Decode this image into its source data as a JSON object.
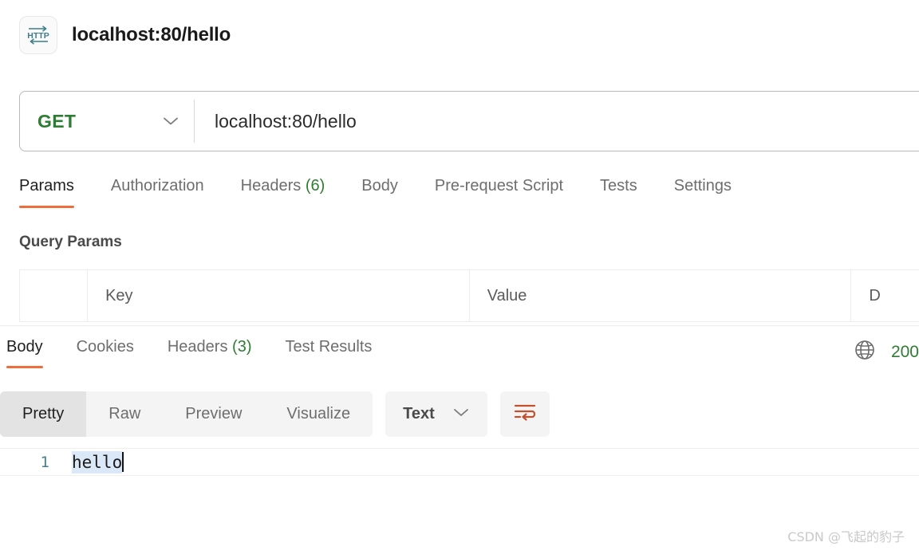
{
  "header": {
    "icon": "http-protocol-icon",
    "title": "localhost:80/hello"
  },
  "request_bar": {
    "method": "GET",
    "method_caret": "chevron-down-icon",
    "url": "localhost:80/hello"
  },
  "request_tabs": [
    {
      "label": "Params",
      "count": "",
      "active": true
    },
    {
      "label": "Authorization",
      "count": "",
      "active": false
    },
    {
      "label": "Headers",
      "count": "(6)",
      "active": false
    },
    {
      "label": "Body",
      "count": "",
      "active": false
    },
    {
      "label": "Pre-request Script",
      "count": "",
      "active": false
    },
    {
      "label": "Tests",
      "count": "",
      "active": false
    },
    {
      "label": "Settings",
      "count": "",
      "active": false
    }
  ],
  "query_params": {
    "section_title": "Query Params",
    "columns": [
      "",
      "Key",
      "Value",
      "D"
    ],
    "rows": []
  },
  "response_tabs": [
    {
      "label": "Body",
      "count": "",
      "active": true
    },
    {
      "label": "Cookies",
      "count": "",
      "active": false
    },
    {
      "label": "Headers",
      "count": "(3)",
      "active": false
    },
    {
      "label": "Test Results",
      "count": "",
      "active": false
    }
  ],
  "response_status": {
    "globe_icon": "globe-icon",
    "code": "200"
  },
  "view_toolbar": {
    "view_modes": [
      {
        "label": "Pretty",
        "active": true
      },
      {
        "label": "Raw",
        "active": false
      },
      {
        "label": "Preview",
        "active": false
      },
      {
        "label": "Visualize",
        "active": false
      }
    ],
    "format_select": {
      "value": "Text",
      "caret": "chevron-down-icon"
    },
    "wrap_button": "wrap-lines-icon"
  },
  "body_view": {
    "lines": [
      {
        "number": "1",
        "text": "hello",
        "selected": true
      }
    ]
  },
  "watermark": "CSDN @飞起的豹子",
  "colors": {
    "accent_orange": "#ef6c3e",
    "method_green": "#2e7d32",
    "status_green": "#2e7d32",
    "icon_teal": "#3b7d8c",
    "wrap_icon_orange": "#c0522e",
    "selection_blue": "#dbe8f7"
  }
}
